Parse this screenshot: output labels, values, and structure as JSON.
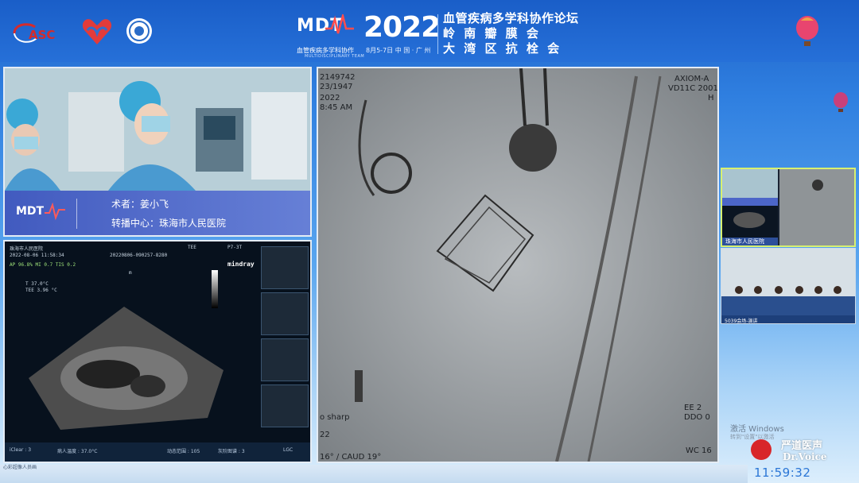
{
  "header": {
    "logo_asc_text": "ASC",
    "mdt_logo_text": "MDT",
    "mdt_subtitle_cn": "血管疾病多学科协作",
    "mdt_subtitle_en": "MULTIDISCIPLINARY TEAM",
    "year": "2022",
    "date_location": "8月5-7日  中 国 · 广 州",
    "title_lines": [
      "血管疾病多学科协作论坛",
      "岭 南 瓣 膜 会",
      "大 湾 区 抗 栓 会"
    ]
  },
  "camera_feed": {
    "surgeon_label": "术者：姜小飞",
    "center_label": "转播中心：珠海市人民医院"
  },
  "echo_feed": {
    "hospital_line": "珠海市人民医院",
    "datetime": "2022-08-06 11:58:34",
    "patient_id": "20220806-090257-8280",
    "params": "AP 96.8%  MI 0.7 TIS 0.2",
    "temp1": "T 37.0°C",
    "temp2": "TEE 3.96 °C",
    "brand": "mindray",
    "mode": "TEE",
    "probe": "P7-3T",
    "depth_marker": "m",
    "bottom_items": [
      "iClear : 3",
      "病人温度 : 37.0°C",
      "动态范围 : 105",
      "灰阶图谱 : 3",
      "LGC"
    ]
  },
  "xray_feed": {
    "top_left_lines": [
      "2149742",
      "23/1947",
      "2022",
      "8:45 AM"
    ],
    "top_right_lines": [
      "AXIOM-A",
      "VD11C 2001",
      "H"
    ],
    "bottom_right_lines": [
      "EE 2",
      "DDO 0"
    ],
    "bottom_left_lines": [
      "o sharp",
      "22",
      "16° / CAUD 19°"
    ],
    "corner_label": "WC 16"
  },
  "thumbnails": {
    "thumb1_label": "珠海市人民医院",
    "thumb2_label": "5039会场-演讲"
  },
  "overlay": {
    "activate_windows": "激活 Windows",
    "activate_sub": "转到\"设置\"以激活",
    "brand_cn": "严道医声",
    "brand_en": "Dr.Voice",
    "clock": "11:59:32",
    "bottom_label": "心彩超像人员画"
  }
}
